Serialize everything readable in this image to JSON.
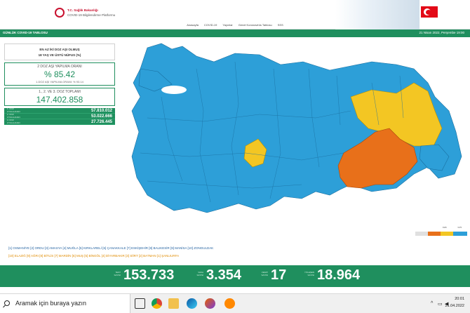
{
  "header": {
    "logo_line1": "T.C. Sağlık Bakanlığı",
    "logo_line2": "COVID-19 Bilgilendirme Platformu"
  },
  "nav": [
    "Anasayfa",
    "COVID-19",
    "Yayınlar",
    "Genel Koronavirüs Tablosu",
    "SSS"
  ],
  "greenbar": {
    "title": "GÜNLÜK COVID-19 TABLOSU",
    "date": "21 Nisan 2022, Perşembe 19:00"
  },
  "left_panel": {
    "head_line1": "EN AZ İKİ DOZ AŞI OLMUŞ",
    "head_line2": "18 YAŞ VE ÜSTÜ NÜFUS (%)",
    "rate_caption": "2 DOZ AŞI YAPILMA ORANI",
    "rate_value": "% 85.42",
    "rate_sub": "1.DOZ AŞI YAPILMA ORANI: % 93.14",
    "total_caption": "1., 2. VE 3. DOZ TOPLAMI",
    "total_value": "147.402.858",
    "rows": [
      {
        "label1": "1. DOZ",
        "label2": "UYGULANAN",
        "value": "57.810.012"
      },
      {
        "label1": "2. DOZ",
        "label2": "UYGULANAN",
        "value": "53.022.666"
      },
      {
        "label1": "3. DOZ",
        "label2": "UYGULANAN",
        "value": "27.726.445"
      }
    ]
  },
  "legend": {
    "labels": [
      "",
      "",
      "%65",
      "%75"
    ],
    "colors": [
      "#e0e0e0",
      "#e8701a",
      "#f3c623",
      "#2d9fd8"
    ]
  },
  "provinces": {
    "blue_line": "[1] OSMANİYE  [2] ORDU  [3] AMASYA  [4] MUĞLA  [5] KIRKLARELİ  [6] ÇANAKKALE  [7] ESKİŞEHİR  [8] BALIKESİR  [9] MANİSA  [10] ZONGULDAK",
    "orange_line": "[10] ELAZIĞ  [9] AĞRI  [8] BİTLİS  [7] MARDİN  [6] MUŞ  [5] BİNGÖL  [4] DİYARBAKIR  [3] SİİRT  [2] BATMAN  [1] ŞANLIURFA"
  },
  "stats": [
    {
      "label1": "TEST",
      "label2": "SAYISI",
      "value": "153.733"
    },
    {
      "label1": "VAKA",
      "label2": "SAYISI",
      "value": "3.354"
    },
    {
      "label1": "VEFAT",
      "label2": "SAYISI",
      "value": "17"
    },
    {
      "label1": "İYİLEŞEN",
      "label2": "SAYISI",
      "value": "18.964"
    }
  ],
  "taskbar": {
    "search_placeholder": "Aramak için buraya yazın",
    "time": "20:01",
    "date": "21.04.2022"
  },
  "colors": {
    "green": "#1f8f5e",
    "map_blue": "#2d9fd8",
    "map_yellow": "#f3c623",
    "map_orange": "#e8701a"
  }
}
